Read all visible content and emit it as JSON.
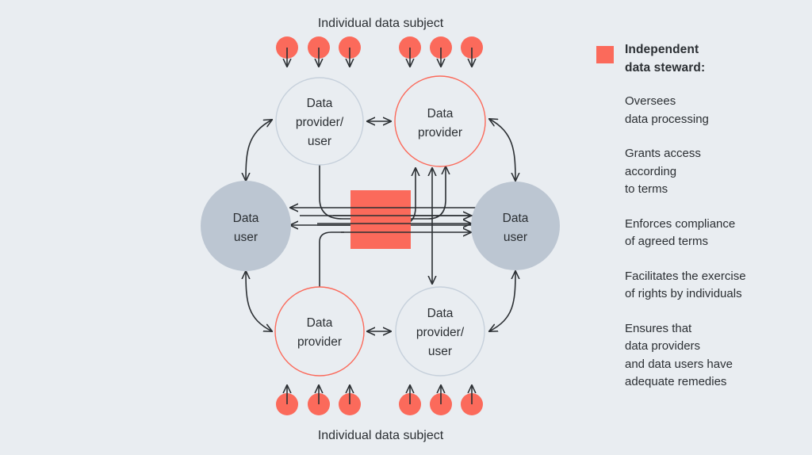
{
  "colors": {
    "background": "#E9EDF1",
    "steward_red": "#FB6A5B",
    "user_circle_gray": "#BCC6D2",
    "provider_outline_gray": "#C6D0DB",
    "provider_outline_red": "#FB6A5B",
    "text": "#2B2F33",
    "arrow": "#2B2F33"
  },
  "captions": {
    "top": "Individual data subject",
    "bottom": "Individual data subject"
  },
  "nodes": [
    {
      "id": "top-left",
      "label": "Data\nprovider/\nuser",
      "type": "provider-user",
      "outline": "gray"
    },
    {
      "id": "top-right",
      "label": "Data\nprovider",
      "type": "provider",
      "outline": "red"
    },
    {
      "id": "left",
      "label": "Data\nuser",
      "type": "user",
      "outline": "filled-gray"
    },
    {
      "id": "right",
      "label": "Data\nuser",
      "type": "user",
      "outline": "filled-gray"
    },
    {
      "id": "bottom-left",
      "label": "Data\nprovider",
      "type": "provider",
      "outline": "red"
    },
    {
      "id": "bottom-right",
      "label": "Data\nprovider/\nuser",
      "type": "provider-user",
      "outline": "gray"
    }
  ],
  "node_text": {
    "top_left": {
      "l1": "Data",
      "l2": "provider/",
      "l3": "user"
    },
    "top_right": {
      "l1": "Data",
      "l2": "provider"
    },
    "left_user": {
      "l1": "Data",
      "l2": "user"
    },
    "right_user": {
      "l1": "Data",
      "l2": "user"
    },
    "bottom_left": {
      "l1": "Data",
      "l2": "provider"
    },
    "bottom_right": {
      "l1": "Data",
      "l2": "provider/",
      "l3": "user"
    }
  },
  "steward": {
    "shape": "square",
    "color": "#FB6A5B",
    "position": "center"
  },
  "data_subjects": {
    "top_count": 6,
    "bottom_count": 6,
    "top_arrow_direction": "down",
    "bottom_arrow_direction": "up",
    "dot_color": "#FB6A5B"
  },
  "legend": {
    "swatch_color": "#FB6A5B",
    "title": "Independent\ndata steward:",
    "title_line1": "Independent",
    "title_line2": "data steward:",
    "items": [
      "Oversees\ndata processing",
      "Grants access\naccording\nto terms",
      "Enforces compliance\nof agreed terms",
      "Facilitates the exercise\nof rights by individuals",
      "Ensures that\ndata providers\nand data users have\nadequate remedies"
    ]
  }
}
